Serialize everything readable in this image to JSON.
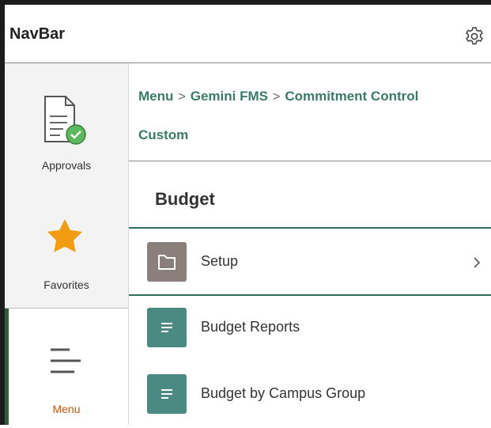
{
  "header": {
    "title": "NavBar",
    "settings_icon": "gear-icon"
  },
  "nav": {
    "items": [
      {
        "label": "Approvals",
        "icon": "document-check-icon"
      },
      {
        "label": "Favorites",
        "icon": "star-icon"
      },
      {
        "label": "Menu",
        "icon": "menu-lines-icon",
        "selected": true
      }
    ]
  },
  "breadcrumb": {
    "items": [
      "Menu",
      "Gemini FMS",
      "Commitment Control Custom"
    ]
  },
  "section": {
    "title": "Budget",
    "items": [
      {
        "label": "Setup",
        "type": "folder",
        "has_children": true
      },
      {
        "label": "Budget Reports",
        "type": "document"
      },
      {
        "label": "Budget by Campus Group",
        "type": "document"
      }
    ]
  },
  "colors": {
    "accent_green": "#2f6d5e",
    "link_green": "#3a7a6a",
    "tile_doc": "#4a8a82",
    "tile_folder": "#8a7f7a",
    "star": "#f39c12",
    "menu_label": "#cc5500"
  }
}
